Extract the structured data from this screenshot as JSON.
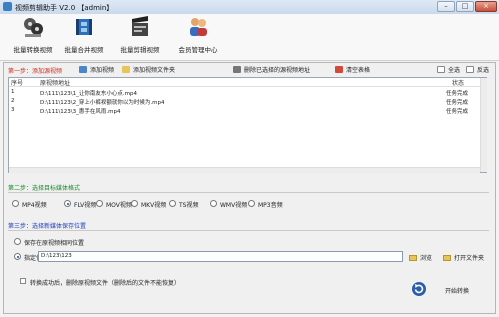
{
  "window": {
    "title": "视频剪辑助手 V2.0 【admin】",
    "controls": [
      "–",
      "□",
      "×"
    ]
  },
  "toolbar": {
    "items": [
      {
        "label": "批量转换视频",
        "icon": "reels-icon"
      },
      {
        "label": "批量合并视频",
        "icon": "film-merge-icon"
      },
      {
        "label": "批量剪辑视频",
        "icon": "clapper-icon"
      },
      {
        "label": "会员管理中心",
        "icon": "users-icon"
      }
    ]
  },
  "step1": {
    "label": "第一步：添加源视频"
  },
  "actions": {
    "add_video": "添加视频",
    "add_folder": "添加视频文件夹",
    "delete_selected": "删除已选择的源视频地址",
    "clear_table": "清空表格",
    "select_all": "全选",
    "invert": "反选"
  },
  "table": {
    "headers": {
      "index": "序号",
      "path": "原视频地址",
      "status": "状态"
    },
    "rows": [
      {
        "index": "1",
        "path": "D:\\111\\123\\1_让你南友东小心点.mp4",
        "status": "任务完成"
      },
      {
        "index": "2",
        "path": "D:\\111\\123\\2_穿上小裤衩额就你以为时候为.mp4",
        "status": "任务完成"
      },
      {
        "index": "3",
        "path": "D:\\111\\123\\3_惠手在风雨.mp4",
        "status": "任务完成"
      }
    ]
  },
  "step2": {
    "label": "第二步：选择目标媒体格式",
    "formats": [
      "MP4视频",
      "FLV视频",
      "MOV视频",
      "MKV视频",
      "TS视频",
      "WMV视频",
      "MP3音频"
    ],
    "selected": "FLV视频"
  },
  "step3": {
    "label": "第三步：选择新媒体保存位置",
    "option_same": "保存在原视频相同位置",
    "option_custom": "指定位置",
    "selected": "指定位置",
    "path_value": "D:\\123\\123",
    "browse": "浏览",
    "open_folder": "打开文件夹"
  },
  "footer": {
    "delete_checkbox": "转换成功后，删除原视频文件（删除后的文件不能恢复）",
    "start_button": "开始转换"
  },
  "colors": {
    "step_red": "#d12b1f",
    "step_green": "#1c8a2a",
    "step_blue": "#1b3fbf"
  }
}
